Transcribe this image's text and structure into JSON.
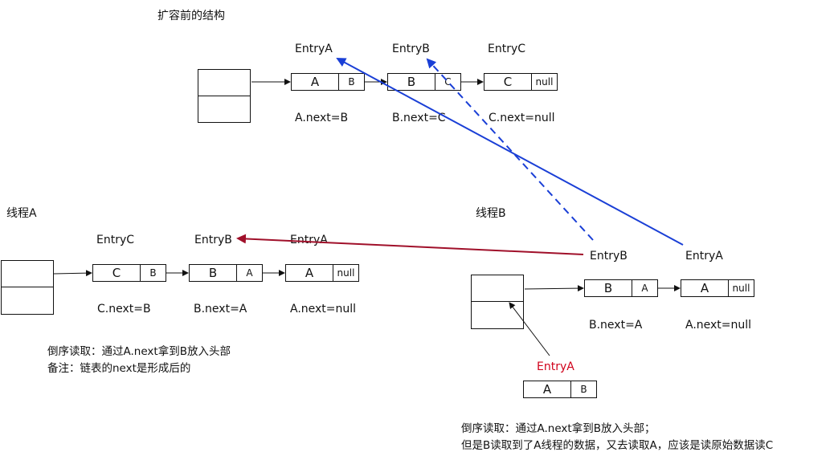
{
  "top": {
    "title": "扩容前的结构",
    "entries": [
      "EntryA",
      "EntryB",
      "EntryC"
    ],
    "nodes": [
      {
        "key": "A",
        "ptr": "B"
      },
      {
        "key": "B",
        "ptr": "C"
      },
      {
        "key": "C",
        "ptr": "null"
      }
    ],
    "nexts": [
      "A.next=B",
      "B.next=C",
      "C.next=null"
    ]
  },
  "threadA": {
    "title": "线程A",
    "entries": [
      "EntryC",
      "EntryB",
      "EntryA"
    ],
    "nodes": [
      {
        "key": "C",
        "ptr": "B"
      },
      {
        "key": "B",
        "ptr": "A"
      },
      {
        "key": "A",
        "ptr": "null"
      }
    ],
    "nexts": [
      "C.next=B",
      "B.next=A",
      "A.next=null"
    ],
    "note_line1": "倒序读取：通过A.next拿到B放入头部",
    "note_line2": "备注：链表的next是形成后的"
  },
  "threadB": {
    "title": "线程B",
    "entries": [
      "EntryB",
      "EntryA"
    ],
    "nodes": [
      {
        "key": "B",
        "ptr": "A"
      },
      {
        "key": "A",
        "ptr": "null"
      }
    ],
    "nexts": [
      "B.next=A",
      "A.next=null"
    ],
    "pending_entry": "EntryA",
    "pending_node": {
      "key": "A",
      "ptr": "B"
    },
    "note_line1": "倒序读取：通过A.next拿到B放入头部；",
    "note_line2": "但是B读取到了A线程的数据，又去读取A，应该是读原始数据读C"
  },
  "colors": {
    "blue": "#1a3fd6",
    "red": "#a0102a",
    "highlight": "#d0021b"
  }
}
